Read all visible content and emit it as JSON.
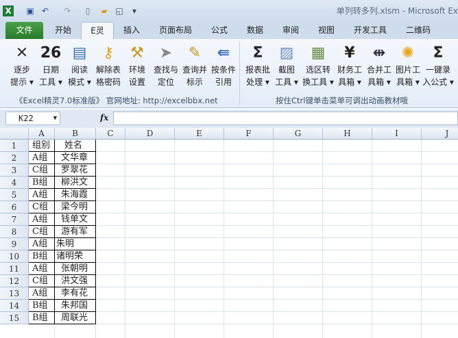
{
  "window": {
    "title": "单列转多列.xlsm - Microsoft Ex"
  },
  "tabs": [
    "文件",
    "开始",
    "E灵",
    "插入",
    "页面布局",
    "公式",
    "数据",
    "审阅",
    "视图",
    "开发工具",
    "二维码"
  ],
  "ribbon": {
    "left_buttons": [
      {
        "l1": "逐步",
        "l2": "提示 ▾",
        "icon": "x-icon"
      },
      {
        "l1": "日期",
        "l2": "工具 ▾",
        "icon": "calendar-icon",
        "num": "26"
      },
      {
        "l1": "阅读",
        "l2": "模式 ▾",
        "icon": "reading-card-icon"
      },
      {
        "l1": "解除表",
        "l2": "格密码",
        "icon": "key-icon"
      },
      {
        "l1": "环境",
        "l2": "设置",
        "icon": "tools-icon"
      },
      {
        "l1": "查找与",
        "l2": "定位",
        "icon": "cursor-icon"
      },
      {
        "l1": "查询并",
        "l2": "标示",
        "icon": "notepad-pencil-icon"
      },
      {
        "l1": "按条件",
        "l2": "引用",
        "icon": "reference-icon"
      }
    ],
    "left_group": "《Excel精灵7.0标准版》 官网地址: http://excelbbx.net",
    "right_buttons": [
      {
        "l1": "报表批",
        "l2": "处理 ▾",
        "icon": "sigma-table-icon"
      },
      {
        "l1": "截图",
        "l2": "工具 ▾",
        "icon": "screenshot-icon"
      },
      {
        "l1": "选区转",
        "l2": "换工具 ▾",
        "icon": "table-hand-icon"
      },
      {
        "l1": "财务工",
        "l2": "具箱 ▾",
        "icon": "yen-icon"
      },
      {
        "l1": "合并工",
        "l2": "具箱 ▾",
        "icon": "merge-icon"
      },
      {
        "l1": "图片工",
        "l2": "具箱 ▾",
        "icon": "sunflower-icon"
      },
      {
        "l1": "一键录",
        "l2": "入公式 ▾",
        "icon": "sigma-icon"
      }
    ],
    "right_group": "按住Ctrl键单击菜单可调出动画教材哦"
  },
  "formula_bar": {
    "name_box": "K22",
    "fx": "fx",
    "value": ""
  },
  "columns": [
    "A",
    "B",
    "C",
    "D",
    "E",
    "F",
    "G",
    "H",
    "I",
    "J"
  ],
  "rows": [
    [
      "组别",
      "姓名"
    ],
    [
      "A组",
      "文华章"
    ],
    [
      "C组",
      "罗翠花"
    ],
    [
      "B组",
      "柳洪文"
    ],
    [
      "A组",
      "朱海霞"
    ],
    [
      "C组",
      "梁今明"
    ],
    [
      "A组",
      "钱单文"
    ],
    [
      "C组",
      "游有军"
    ],
    [
      "A组",
      "朱明"
    ],
    [
      "B组",
      "诸明荣"
    ],
    [
      "A组",
      "张朝明"
    ],
    [
      "C组",
      "洪文强"
    ],
    [
      "A组",
      "李有花"
    ],
    [
      "B组",
      "朱邦国"
    ],
    [
      "B组",
      "周联光"
    ]
  ]
}
